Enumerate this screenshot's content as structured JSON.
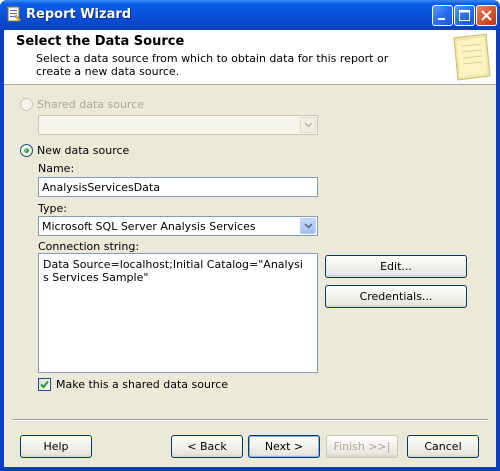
{
  "window": {
    "title": "Report Wizard",
    "icon": "report-wizard-icon"
  },
  "header": {
    "title": "Select the Data Source",
    "description": "Select a data source from which to obtain data for this report or create a new data source."
  },
  "shared_source": {
    "label": "Shared data source",
    "selected": false,
    "enabled": false,
    "value": ""
  },
  "new_source": {
    "label": "New data source",
    "selected": true,
    "name_label": "Name:",
    "name_value": "AnalysisServicesData",
    "type_label": "Type:",
    "type_value": "Microsoft SQL Server Analysis Services",
    "conn_label": "Connection string:",
    "conn_value": "Data Source=localhost;Initial Catalog=\"Analysis Services Sample\"",
    "edit_label": "Edit...",
    "credentials_label": "Credentials..."
  },
  "shared_checkbox": {
    "label": "Make this a shared data source",
    "checked": true
  },
  "footer": {
    "help_label": "Help",
    "back_label": "< Back",
    "next_label": "Next >",
    "finish_label": "Finish >>|",
    "cancel_label": "Cancel"
  },
  "colors": {
    "title_bar": "#0a4fd8",
    "dialog_bg": "#ece9d8",
    "radio_selected": "#21a121",
    "check_mark": "#21a121"
  }
}
